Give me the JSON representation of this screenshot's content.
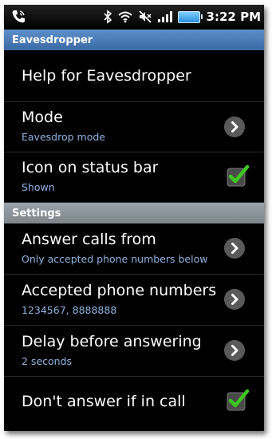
{
  "statusbar": {
    "time": "3:22 PM",
    "icons": [
      "phone-call-icon",
      "bluetooth-icon",
      "wifi-icon",
      "muted-speaker-icon",
      "signal-bars-icon",
      "battery-icon"
    ]
  },
  "sections": [
    {
      "header": "Eavesdropper",
      "items": [
        {
          "title": "Help for Eavesdropper",
          "summary": "",
          "widget": "none"
        },
        {
          "title": "Mode",
          "summary": "Eavesdrop mode",
          "widget": "chevron"
        },
        {
          "title": "Icon on status bar",
          "summary": "Shown",
          "widget": "checkbox",
          "checked": true
        }
      ]
    },
    {
      "header": "Settings",
      "items": [
        {
          "title": "Answer calls from",
          "summary": "Only accepted phone numbers below",
          "widget": "chevron"
        },
        {
          "title": "Accepted phone numbers",
          "summary": "1234567, 8888888",
          "widget": "chevron"
        },
        {
          "title": "Delay before answering",
          "summary": "2 seconds",
          "widget": "chevron"
        },
        {
          "title": "Don't answer if in call",
          "summary": "",
          "widget": "checkbox",
          "checked": true
        }
      ]
    }
  ],
  "colors": {
    "background": "#000000",
    "header_blue": "#4a7bb8",
    "header_gray": "#8a929a",
    "summary_text": "#8fb3e0",
    "check_green": "#3cc81e"
  }
}
